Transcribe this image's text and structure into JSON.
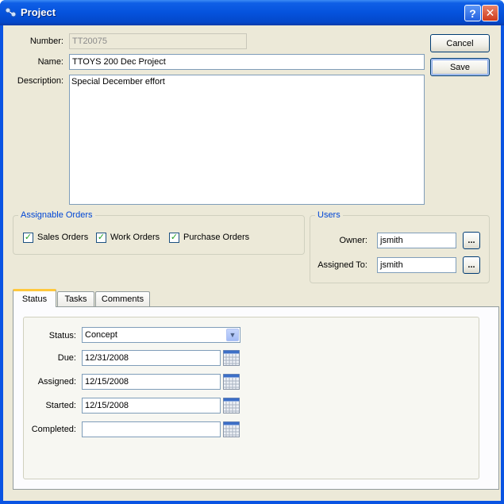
{
  "window": {
    "title": "Project"
  },
  "form": {
    "number_label": "Number:",
    "number_value": "TT20075",
    "name_label": "Name:",
    "name_value": "TTOYS 200 Dec Project",
    "description_label": "Description:",
    "description_value": "Special December effort"
  },
  "buttons": {
    "cancel": "Cancel",
    "save": "Save"
  },
  "assignable_orders": {
    "title": "Assignable Orders",
    "items": [
      {
        "label": "Sales Orders",
        "checked": true
      },
      {
        "label": "Work Orders",
        "checked": true
      },
      {
        "label": "Purchase Orders",
        "checked": true
      }
    ]
  },
  "users": {
    "title": "Users",
    "owner_label": "Owner:",
    "owner_value": "jsmith",
    "assigned_to_label": "Assigned To:",
    "assigned_to_value": "jsmith",
    "browse_label": "..."
  },
  "tabs": [
    {
      "label": "Status",
      "active": true
    },
    {
      "label": "Tasks",
      "active": false
    },
    {
      "label": "Comments",
      "active": false
    }
  ],
  "status_tab": {
    "status_label": "Status:",
    "status_value": "Concept",
    "due_label": "Due:",
    "due_value": "12/31/2008",
    "assigned_label": "Assigned:",
    "assigned_value": "12/15/2008",
    "started_label": "Started:",
    "started_value": "12/15/2008",
    "completed_label": "Completed:",
    "completed_value": ""
  },
  "colors": {
    "title_bar": "#0553dd",
    "client_bg": "#ece9d8",
    "group_title": "#0046d5",
    "tab_highlight": "#ffc83c"
  }
}
